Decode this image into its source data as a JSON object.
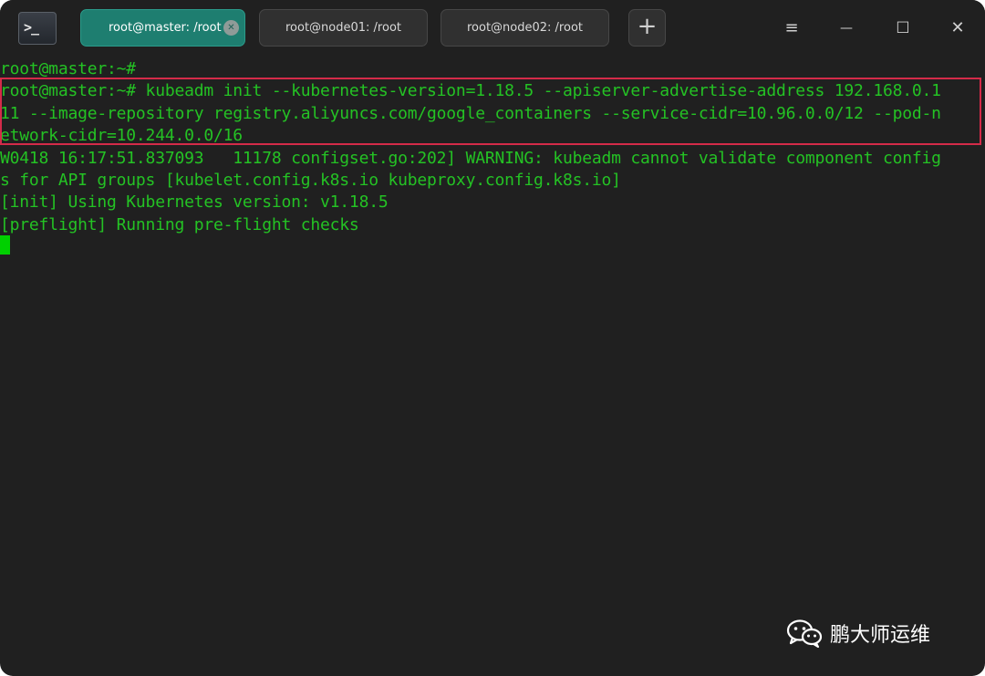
{
  "tabs": [
    {
      "label": "root@master: /root",
      "active": true
    },
    {
      "label": "root@node01: /root",
      "active": false
    },
    {
      "label": "root@node02: /root",
      "active": false
    }
  ],
  "window_controls": {
    "menu_icon": "≡",
    "minimize_icon": "—",
    "maximize_icon": "☐",
    "close_icon": "✕",
    "new_tab_icon": "+"
  },
  "app_icon": "terminal-icon",
  "terminal": {
    "lines": [
      "root@master:~#",
      "root@master:~# kubeadm init --kubernetes-version=1.18.5 --apiserver-advertise-address 192.168.0.1",
      "11 --image-repository registry.aliyuncs.com/google_containers --service-cidr=10.96.0.0/12 --pod-n",
      "etwork-cidr=10.244.0.0/16",
      "W0418 16:17:51.837093   11178 configset.go:202] WARNING: kubeadm cannot validate component config",
      "s for API groups [kubelet.config.k8s.io kubeproxy.config.k8s.io]",
      "[init] Using Kubernetes version: v1.18.5",
      "[preflight] Running pre-flight checks"
    ]
  },
  "watermark": {
    "text": "鹏大师运维",
    "icon": "wechat-icon"
  },
  "colors": {
    "terminal_text": "#24c224",
    "active_tab": "#1e7e70",
    "highlight_border": "#d42b49",
    "background": "#202020"
  }
}
